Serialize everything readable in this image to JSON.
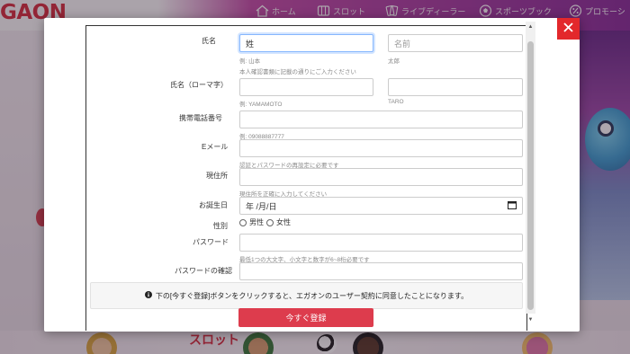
{
  "site": {
    "brand": "GAON",
    "nav": [
      {
        "label": "ホーム",
        "icon": "home-icon"
      },
      {
        "label": "スロット",
        "icon": "slot-machine-icon"
      },
      {
        "label": "ライブディーラー",
        "icon": "cards-icon"
      },
      {
        "label": "スポーツブック",
        "icon": "ball-icon"
      },
      {
        "label": "プロモーシ",
        "icon": "percent-icon"
      }
    ],
    "bottom_banner": "スロット"
  },
  "form": {
    "name": {
      "label": "氏名",
      "last_value": "姓",
      "first_placeholder": "名前",
      "last_example": "例: 山本",
      "first_example": "太郎",
      "hint": "本人確認書類に記載の通りにご入力ください"
    },
    "name_roman": {
      "label": "氏名（ローマ字）",
      "last_example": "例: YAMAMOTO",
      "first_example": "TARO"
    },
    "phone": {
      "label": "携帯電話番号",
      "example": "例: 09088887777"
    },
    "email": {
      "label": "Eメール",
      "hint": "認証とパスワードの再設定に必要です"
    },
    "address": {
      "label": "現住所",
      "hint": "現住所を正確に入力してください"
    },
    "birthday": {
      "label": "お誕生日",
      "value": "年 /月/日"
    },
    "gender": {
      "label": "性別",
      "male": "男性",
      "female": "女性"
    },
    "password": {
      "label": "パスワード",
      "hint": "最低1つの大文字、小文字と数字が6~8桁必要です"
    },
    "password_confirm": {
      "label": "パスワードの確認"
    },
    "notice": "下の[今すぐ登録]ボタンをクリックすると、エガオンのユーザー契約に同意したことになります。",
    "submit_label": "今すぐ登録"
  },
  "colors": {
    "close_button": "#e3282c",
    "submit_button": "#dd3c4d",
    "focus_ring": "#86b7fe"
  }
}
